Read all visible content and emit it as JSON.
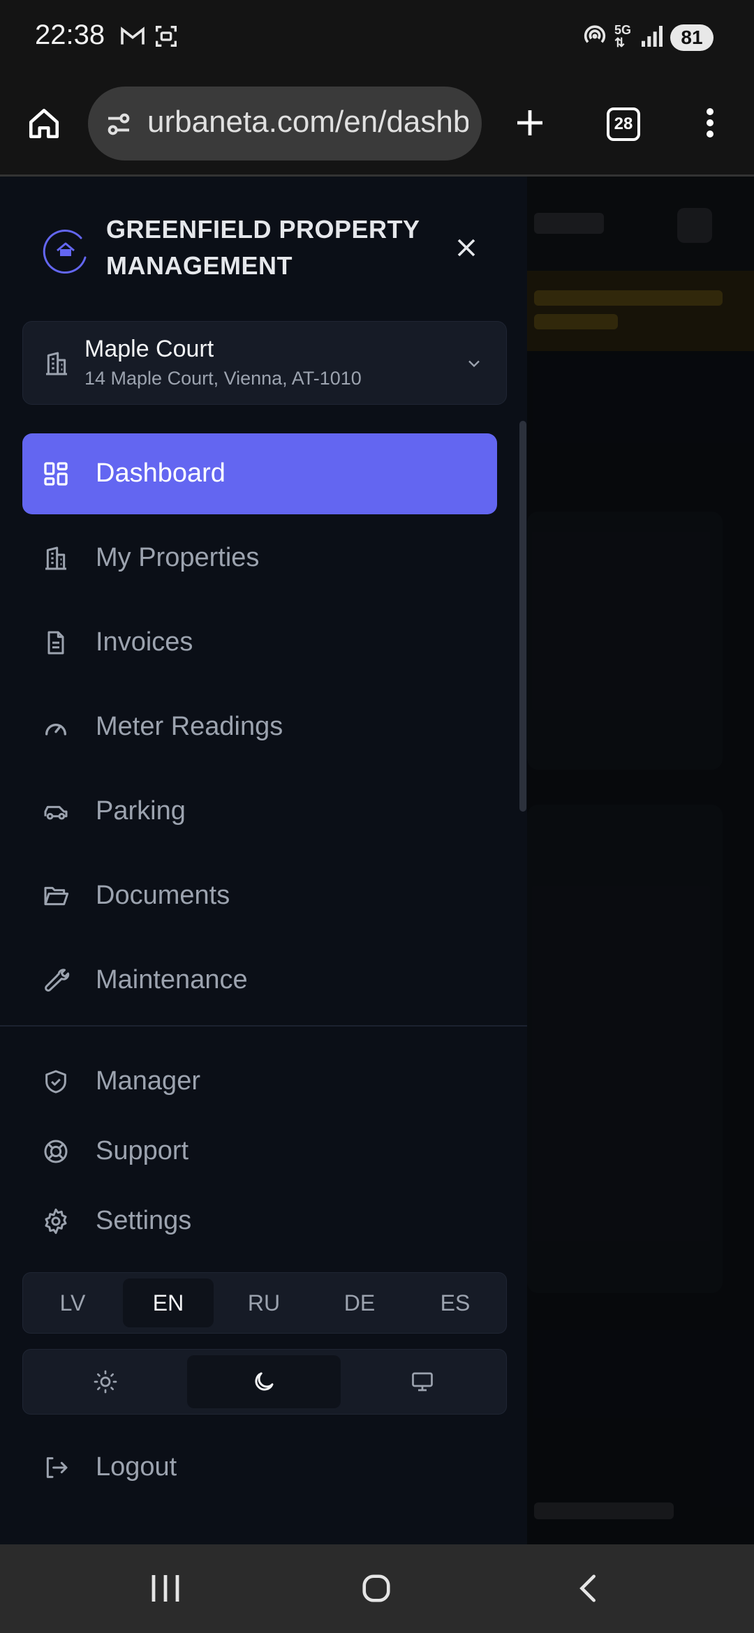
{
  "status_bar": {
    "time": "22:38",
    "battery": "81"
  },
  "browser": {
    "url": "urbaneta.com/en/dashboard",
    "tab_count": "28"
  },
  "brand": {
    "name": "GREENFIELD PROPERTY MANAGEMENT",
    "accent": "#6366f1"
  },
  "property": {
    "name": "Maple Court",
    "address": "14 Maple Court, Vienna, AT-1010"
  },
  "nav": {
    "items": [
      {
        "label": "Dashboard",
        "icon": "dashboard-grid-icon",
        "active": true
      },
      {
        "label": "My Properties",
        "icon": "building-icon"
      },
      {
        "label": "Invoices",
        "icon": "document-icon"
      },
      {
        "label": "Meter Readings",
        "icon": "gauge-icon"
      },
      {
        "label": "Parking",
        "icon": "car-icon"
      },
      {
        "label": "Documents",
        "icon": "folder-icon"
      },
      {
        "label": "Maintenance",
        "icon": "wrench-icon"
      }
    ],
    "secondary": [
      {
        "label": "Manager",
        "icon": "shield-check-icon"
      },
      {
        "label": "Support",
        "icon": "lifebuoy-icon"
      },
      {
        "label": "Settings",
        "icon": "gear-icon"
      }
    ]
  },
  "languages": {
    "options": [
      "LV",
      "EN",
      "RU",
      "DE",
      "ES"
    ],
    "selected": "EN"
  },
  "theme": {
    "options": [
      "light",
      "dark",
      "system"
    ],
    "selected": "dark"
  },
  "logout_label": "Logout"
}
